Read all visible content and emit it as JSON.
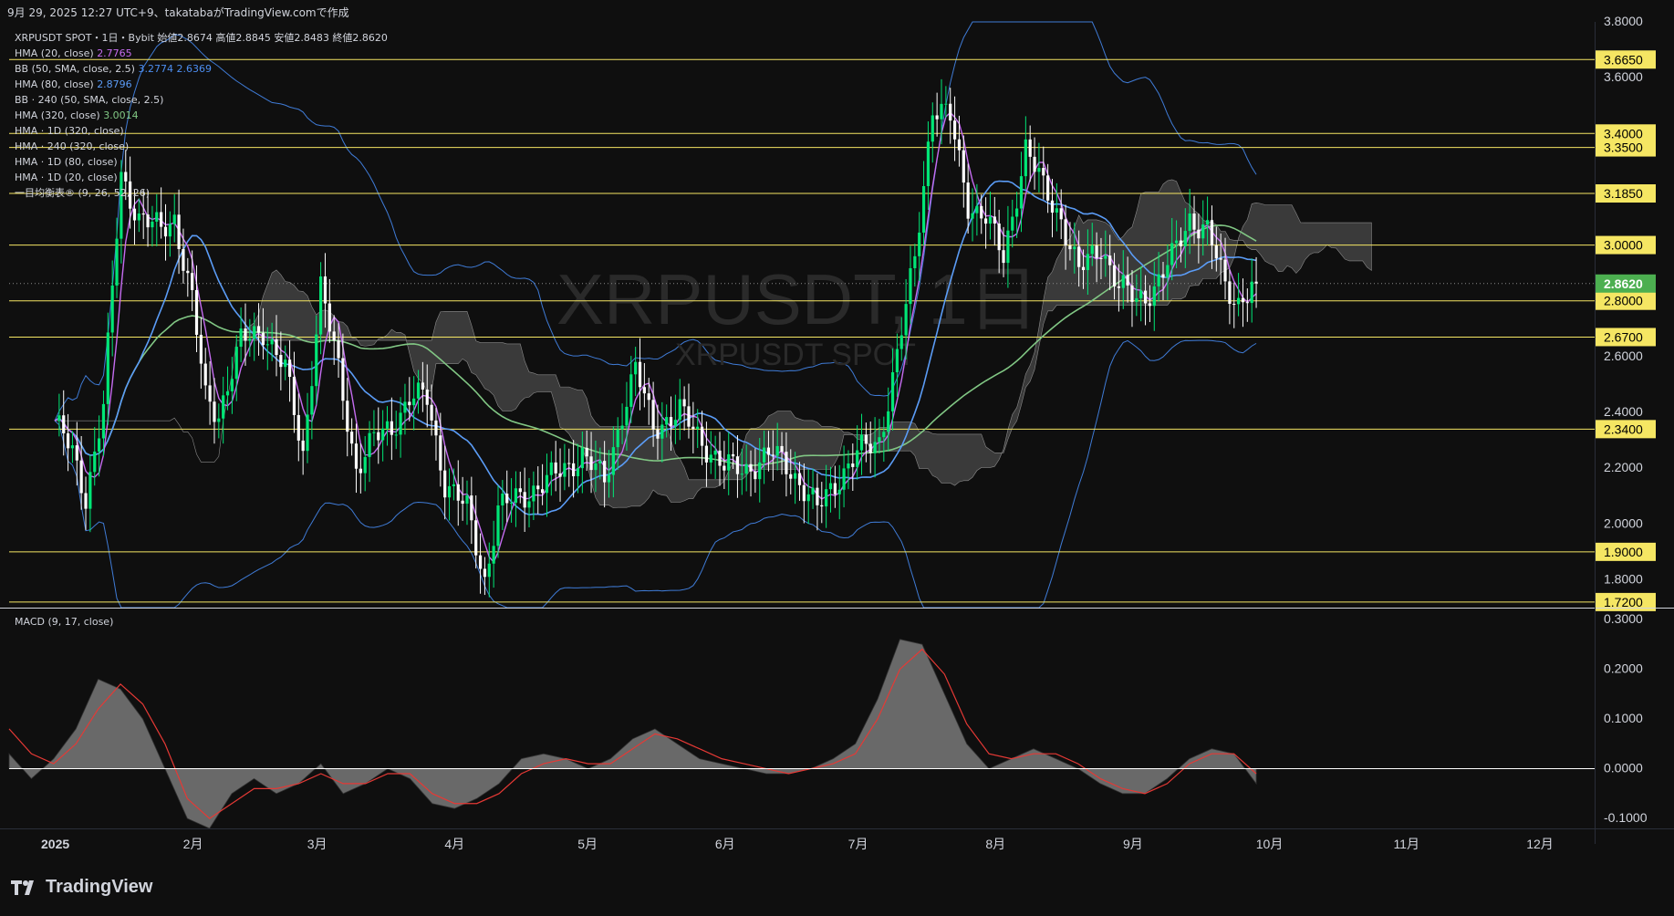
{
  "header": {
    "caption": "9月 29, 2025 12:27 UTC+9、takatabaがTradingView.comで作成"
  },
  "symbol_line": {
    "symbol": "XRPUSDT SPOT・1日・Bybit",
    "o_label": "始値",
    "o": "2.8674",
    "h_label": "高値",
    "h": "2.8845",
    "l_label": "安値",
    "l": "2.8483",
    "c_label": "終値",
    "c": "2.8620"
  },
  "indicators": [
    {
      "label": "HMA (20, close)",
      "value": "2.7765",
      "color": "#c56cf0"
    },
    {
      "label": "BB (50, SMA, close, 2.5)",
      "value": "3.2774",
      "value2": "2.6369",
      "color": "#4d8ef0"
    },
    {
      "label": "HMA (80, close)",
      "value": "2.8796",
      "color": "#5b9cf6"
    },
    {
      "label": "BB · 240 (50, SMA, close, 2.5)",
      "value": "",
      "color": "#d1d4dc"
    },
    {
      "label": "HMA (320, close)",
      "value": "3.0014",
      "color": "#81c784"
    },
    {
      "label": "HMA · 1D (320, close)",
      "value": "",
      "color": "#d1d4dc"
    },
    {
      "label": "HMA · 240 (320, close)",
      "value": "",
      "color": "#d1d4dc"
    },
    {
      "label": "HMA · 1D (80, close)",
      "value": "",
      "color": "#d1d4dc"
    },
    {
      "label": "HMA · 1D (20, close)",
      "value": "",
      "color": "#d1d4dc"
    },
    {
      "label": "一目均衡表® (9, 26, 52, 26)",
      "value": "",
      "color": "#d1d4dc"
    }
  ],
  "watermark": {
    "line1": "XRPUSDT, 1日",
    "line2": "XRPUSDT SPOT"
  },
  "macd_label": "MACD (9, 17, close)",
  "logo_text": "TradingView",
  "colors": {
    "background": "#0f0f0f",
    "up": "#4caf50",
    "up_bright": "#00e676",
    "down": "#ffffff",
    "level_line": "#f5e663",
    "hma20": "#c56cf0",
    "hma80": "#5b9cf6",
    "hma320": "#81c784",
    "bb": "#3f7bd6",
    "cloud": "#6e6e6e",
    "macd_signal": "#e53935",
    "last_price": "#4caf50"
  },
  "chart_data": {
    "type": "candlestick",
    "title": "XRPUSDT, 1日",
    "y_axis": {
      "min": 1.7,
      "max": 3.8,
      "ticks": [
        "1.8000",
        "2.0000",
        "2.2000",
        "2.4000",
        "2.6000",
        "3.6000",
        "3.8000"
      ]
    },
    "x_axis": {
      "ticks": [
        "2025",
        "2月",
        "3月",
        "4月",
        "5月",
        "6月",
        "7月",
        "8月",
        "9月",
        "10月",
        "11月",
        "12月"
      ]
    },
    "horizontal_levels": [
      "3.6650",
      "3.4000",
      "3.3500",
      "3.1850",
      "3.0000",
      "2.8000",
      "2.6700",
      "2.3400",
      "1.9000",
      "1.7200"
    ],
    "last_price": "2.8620",
    "ohlc_series": [
      {
        "x": "01-01",
        "close": 2.37
      },
      {
        "x": "01-05",
        "close": 2.25
      },
      {
        "x": "01-08",
        "close": 2.1
      },
      {
        "x": "01-12",
        "close": 2.42
      },
      {
        "x": "01-16",
        "close": 3.25
      },
      {
        "x": "01-20",
        "close": 3.1
      },
      {
        "x": "01-25",
        "close": 3.05
      },
      {
        "x": "01-28",
        "close": 3.1
      },
      {
        "x": "02-01",
        "close": 2.8
      },
      {
        "x": "02-04",
        "close": 2.45
      },
      {
        "x": "02-07",
        "close": 2.4
      },
      {
        "x": "02-12",
        "close": 2.65
      },
      {
        "x": "02-17",
        "close": 2.7
      },
      {
        "x": "02-22",
        "close": 2.55
      },
      {
        "x": "02-26",
        "close": 2.25
      },
      {
        "x": "03-02",
        "close": 2.85
      },
      {
        "x": "03-06",
        "close": 2.55
      },
      {
        "x": "03-10",
        "close": 2.2
      },
      {
        "x": "03-14",
        "close": 2.3
      },
      {
        "x": "03-18",
        "close": 2.35
      },
      {
        "x": "03-22",
        "close": 2.45
      },
      {
        "x": "03-26",
        "close": 2.45
      },
      {
        "x": "03-30",
        "close": 2.15
      },
      {
        "x": "04-04",
        "close": 2.05
      },
      {
        "x": "04-08",
        "close": 1.8
      },
      {
        "x": "04-11",
        "close": 2.05
      },
      {
        "x": "04-16",
        "close": 2.1
      },
      {
        "x": "04-22",
        "close": 2.15
      },
      {
        "x": "04-26",
        "close": 2.2
      },
      {
        "x": "04-30",
        "close": 2.25
      },
      {
        "x": "05-05",
        "close": 2.15
      },
      {
        "x": "05-09",
        "close": 2.4
      },
      {
        "x": "05-12",
        "close": 2.55
      },
      {
        "x": "05-16",
        "close": 2.35
      },
      {
        "x": "05-22",
        "close": 2.4
      },
      {
        "x": "05-27",
        "close": 2.3
      },
      {
        "x": "06-01",
        "close": 2.2
      },
      {
        "x": "06-06",
        "close": 2.2
      },
      {
        "x": "06-12",
        "close": 2.25
      },
      {
        "x": "06-16",
        "close": 2.2
      },
      {
        "x": "06-22",
        "close": 2.05
      },
      {
        "x": "06-26",
        "close": 2.15
      },
      {
        "x": "07-01",
        "close": 2.25
      },
      {
        "x": "07-06",
        "close": 2.3
      },
      {
        "x": "07-10",
        "close": 2.6
      },
      {
        "x": "07-14",
        "close": 2.95
      },
      {
        "x": "07-18",
        "close": 3.5
      },
      {
        "x": "07-22",
        "close": 3.45
      },
      {
        "x": "07-26",
        "close": 3.15
      },
      {
        "x": "07-30",
        "close": 3.1
      },
      {
        "x": "08-03",
        "close": 2.95
      },
      {
        "x": "08-08",
        "close": 3.35
      },
      {
        "x": "08-12",
        "close": 3.2
      },
      {
        "x": "08-16",
        "close": 3.1
      },
      {
        "x": "08-20",
        "close": 2.9
      },
      {
        "x": "08-25",
        "close": 3.0
      },
      {
        "x": "08-29",
        "close": 2.85
      },
      {
        "x": "09-02",
        "close": 2.8
      },
      {
        "x": "09-06",
        "close": 2.85
      },
      {
        "x": "09-10",
        "close": 2.95
      },
      {
        "x": "09-14",
        "close": 3.1
      },
      {
        "x": "09-18",
        "close": 3.05
      },
      {
        "x": "09-22",
        "close": 2.85
      },
      {
        "x": "09-25",
        "close": 2.8
      },
      {
        "x": "09-29",
        "close": 2.862
      }
    ],
    "macd": {
      "y_ticks": [
        "0.3000",
        "0.2000",
        "0.1000",
        "0.0000",
        "-0.1000"
      ],
      "ylim": [
        -0.12,
        0.32
      ],
      "values": [
        0.03,
        -0.02,
        0.02,
        0.08,
        0.18,
        0.16,
        0.1,
        0.0,
        -0.1,
        -0.12,
        -0.05,
        -0.02,
        -0.05,
        -0.03,
        0.01,
        -0.05,
        -0.03,
        0.0,
        -0.02,
        -0.07,
        -0.08,
        -0.06,
        -0.03,
        0.02,
        0.03,
        0.02,
        0.0,
        0.02,
        0.06,
        0.08,
        0.05,
        0.02,
        0.01,
        0.0,
        -0.01,
        -0.01,
        0.0,
        0.02,
        0.05,
        0.14,
        0.26,
        0.25,
        0.15,
        0.05,
        0.0,
        0.02,
        0.04,
        0.02,
        0.0,
        -0.03,
        -0.05,
        -0.05,
        -0.02,
        0.02,
        0.04,
        0.03,
        -0.03
      ],
      "signal": [
        0.08,
        0.03,
        0.01,
        0.05,
        0.12,
        0.17,
        0.13,
        0.05,
        -0.06,
        -0.1,
        -0.07,
        -0.04,
        -0.04,
        -0.03,
        -0.01,
        -0.03,
        -0.03,
        -0.01,
        -0.01,
        -0.05,
        -0.07,
        -0.07,
        -0.05,
        -0.01,
        0.01,
        0.02,
        0.01,
        0.01,
        0.04,
        0.07,
        0.06,
        0.04,
        0.02,
        0.01,
        0.0,
        -0.01,
        0.0,
        0.01,
        0.03,
        0.1,
        0.2,
        0.24,
        0.19,
        0.09,
        0.03,
        0.02,
        0.03,
        0.03,
        0.01,
        -0.02,
        -0.04,
        -0.05,
        -0.03,
        0.01,
        0.03,
        0.03,
        -0.01
      ]
    }
  }
}
